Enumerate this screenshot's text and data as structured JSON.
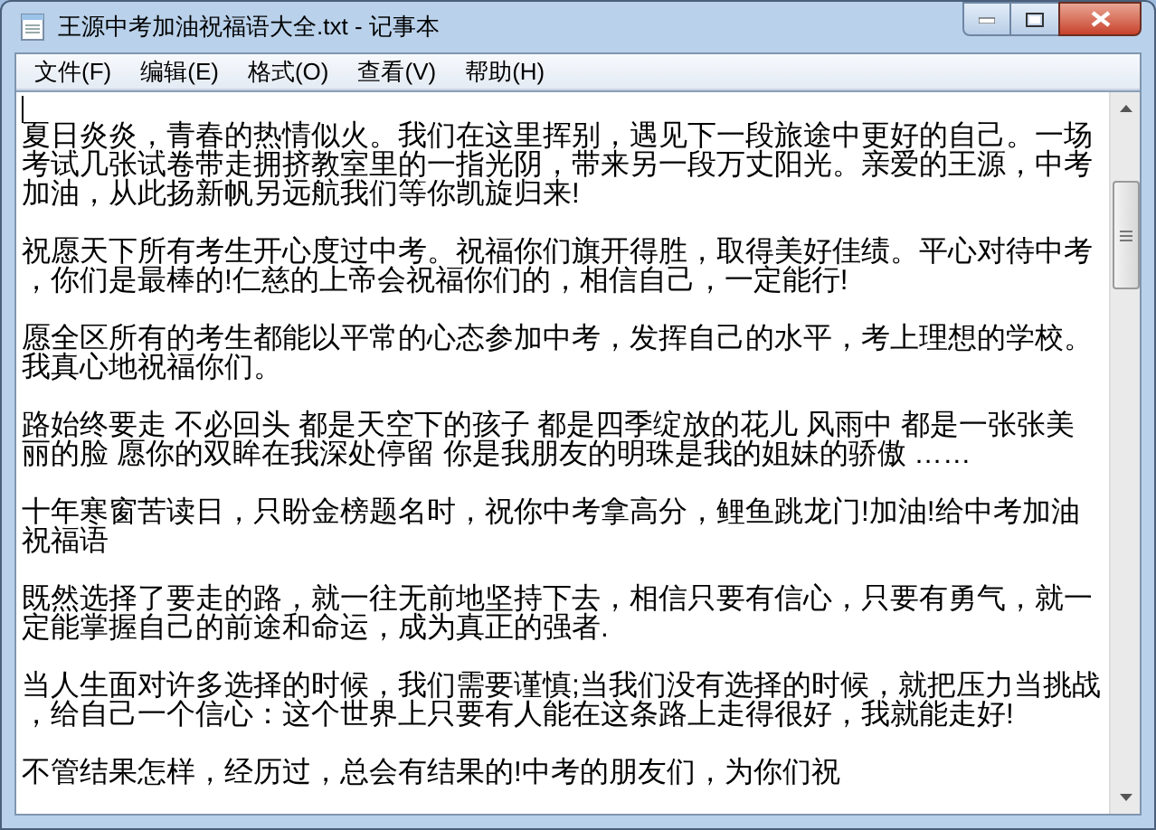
{
  "window": {
    "title": "王源中考加油祝福语大全.txt - 记事本"
  },
  "menu": [
    "文件(F)",
    "编辑(E)",
    "格式(O)",
    "查看(V)",
    "帮助(H)"
  ],
  "document": {
    "paragraphs": [
      {
        "lines": [
          "夏日炎炎，青春的热情似火。我们在这里挥别，遇见下一段旅途中更好的自己。一场",
          "考试几张试卷带走拥挤教室里的一指光阴，带来另一段万丈阳光。亲爱的王源，中考",
          "加油，从此扬新帆另远航我们等你凯旋归来!"
        ]
      },
      {
        "lines": [
          "祝愿天下所有考生开心度过中考。祝福你们旗开得胜，取得美好佳绩。平心对待中考",
          "，你们是最棒的!仁慈的上帝会祝福你们的，相信自己，一定能行!"
        ]
      },
      {
        "lines": [
          "愿全区所有的考生都能以平常的心态参加中考，发挥自己的水平，考上理想的学校。",
          "我真心地祝福你们。"
        ]
      },
      {
        "lines": [
          "路始终要走 不必回头 都是天空下的孩子 都是四季绽放的花儿 风雨中 都是一张张美",
          "丽的脸 愿你的双眸在我深处停留 你是我朋友的明珠是我的姐妹的骄傲 ……"
        ]
      },
      {
        "lines": [
          "十年寒窗苦读日，只盼金榜题名时，祝你中考拿高分，鲤鱼跳龙门!加油!给中考加油",
          "祝福语"
        ]
      },
      {
        "lines": [
          "既然选择了要走的路，就一往无前地坚持下去，相信只要有信心，只要有勇气，就一",
          "定能掌握自己的前途和命运，成为真正的强者."
        ]
      },
      {
        "lines": [
          "当人生面对许多选择的时候，我们需要谨慎;当我们没有选择的时候，就把压力当挑战",
          "，给自己一个信心：这个世界上只要有人能在这条路上走得很好，我就能走好!"
        ]
      },
      {
        "lines": [
          "不管结果怎样，经历过，总会有结果的!中考的朋友们，为你们祝"
        ]
      }
    ]
  }
}
